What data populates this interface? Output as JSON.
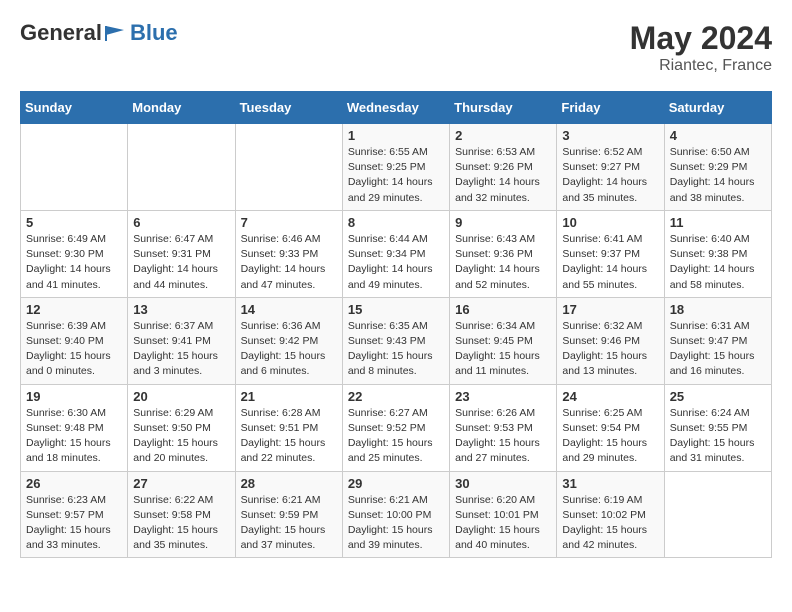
{
  "header": {
    "logo_general": "General",
    "logo_blue": "Blue",
    "month_year": "May 2024",
    "location": "Riantec, France"
  },
  "weekdays": [
    "Sunday",
    "Monday",
    "Tuesday",
    "Wednesday",
    "Thursday",
    "Friday",
    "Saturday"
  ],
  "weeks": [
    [
      {
        "day": "",
        "info": ""
      },
      {
        "day": "",
        "info": ""
      },
      {
        "day": "",
        "info": ""
      },
      {
        "day": "1",
        "info": "Sunrise: 6:55 AM\nSunset: 9:25 PM\nDaylight: 14 hours\nand 29 minutes."
      },
      {
        "day": "2",
        "info": "Sunrise: 6:53 AM\nSunset: 9:26 PM\nDaylight: 14 hours\nand 32 minutes."
      },
      {
        "day": "3",
        "info": "Sunrise: 6:52 AM\nSunset: 9:27 PM\nDaylight: 14 hours\nand 35 minutes."
      },
      {
        "day": "4",
        "info": "Sunrise: 6:50 AM\nSunset: 9:29 PM\nDaylight: 14 hours\nand 38 minutes."
      }
    ],
    [
      {
        "day": "5",
        "info": "Sunrise: 6:49 AM\nSunset: 9:30 PM\nDaylight: 14 hours\nand 41 minutes."
      },
      {
        "day": "6",
        "info": "Sunrise: 6:47 AM\nSunset: 9:31 PM\nDaylight: 14 hours\nand 44 minutes."
      },
      {
        "day": "7",
        "info": "Sunrise: 6:46 AM\nSunset: 9:33 PM\nDaylight: 14 hours\nand 47 minutes."
      },
      {
        "day": "8",
        "info": "Sunrise: 6:44 AM\nSunset: 9:34 PM\nDaylight: 14 hours\nand 49 minutes."
      },
      {
        "day": "9",
        "info": "Sunrise: 6:43 AM\nSunset: 9:36 PM\nDaylight: 14 hours\nand 52 minutes."
      },
      {
        "day": "10",
        "info": "Sunrise: 6:41 AM\nSunset: 9:37 PM\nDaylight: 14 hours\nand 55 minutes."
      },
      {
        "day": "11",
        "info": "Sunrise: 6:40 AM\nSunset: 9:38 PM\nDaylight: 14 hours\nand 58 minutes."
      }
    ],
    [
      {
        "day": "12",
        "info": "Sunrise: 6:39 AM\nSunset: 9:40 PM\nDaylight: 15 hours\nand 0 minutes."
      },
      {
        "day": "13",
        "info": "Sunrise: 6:37 AM\nSunset: 9:41 PM\nDaylight: 15 hours\nand 3 minutes."
      },
      {
        "day": "14",
        "info": "Sunrise: 6:36 AM\nSunset: 9:42 PM\nDaylight: 15 hours\nand 6 minutes."
      },
      {
        "day": "15",
        "info": "Sunrise: 6:35 AM\nSunset: 9:43 PM\nDaylight: 15 hours\nand 8 minutes."
      },
      {
        "day": "16",
        "info": "Sunrise: 6:34 AM\nSunset: 9:45 PM\nDaylight: 15 hours\nand 11 minutes."
      },
      {
        "day": "17",
        "info": "Sunrise: 6:32 AM\nSunset: 9:46 PM\nDaylight: 15 hours\nand 13 minutes."
      },
      {
        "day": "18",
        "info": "Sunrise: 6:31 AM\nSunset: 9:47 PM\nDaylight: 15 hours\nand 16 minutes."
      }
    ],
    [
      {
        "day": "19",
        "info": "Sunrise: 6:30 AM\nSunset: 9:48 PM\nDaylight: 15 hours\nand 18 minutes."
      },
      {
        "day": "20",
        "info": "Sunrise: 6:29 AM\nSunset: 9:50 PM\nDaylight: 15 hours\nand 20 minutes."
      },
      {
        "day": "21",
        "info": "Sunrise: 6:28 AM\nSunset: 9:51 PM\nDaylight: 15 hours\nand 22 minutes."
      },
      {
        "day": "22",
        "info": "Sunrise: 6:27 AM\nSunset: 9:52 PM\nDaylight: 15 hours\nand 25 minutes."
      },
      {
        "day": "23",
        "info": "Sunrise: 6:26 AM\nSunset: 9:53 PM\nDaylight: 15 hours\nand 27 minutes."
      },
      {
        "day": "24",
        "info": "Sunrise: 6:25 AM\nSunset: 9:54 PM\nDaylight: 15 hours\nand 29 minutes."
      },
      {
        "day": "25",
        "info": "Sunrise: 6:24 AM\nSunset: 9:55 PM\nDaylight: 15 hours\nand 31 minutes."
      }
    ],
    [
      {
        "day": "26",
        "info": "Sunrise: 6:23 AM\nSunset: 9:57 PM\nDaylight: 15 hours\nand 33 minutes."
      },
      {
        "day": "27",
        "info": "Sunrise: 6:22 AM\nSunset: 9:58 PM\nDaylight: 15 hours\nand 35 minutes."
      },
      {
        "day": "28",
        "info": "Sunrise: 6:21 AM\nSunset: 9:59 PM\nDaylight: 15 hours\nand 37 minutes."
      },
      {
        "day": "29",
        "info": "Sunrise: 6:21 AM\nSunset: 10:00 PM\nDaylight: 15 hours\nand 39 minutes."
      },
      {
        "day": "30",
        "info": "Sunrise: 6:20 AM\nSunset: 10:01 PM\nDaylight: 15 hours\nand 40 minutes."
      },
      {
        "day": "31",
        "info": "Sunrise: 6:19 AM\nSunset: 10:02 PM\nDaylight: 15 hours\nand 42 minutes."
      },
      {
        "day": "",
        "info": ""
      }
    ]
  ]
}
